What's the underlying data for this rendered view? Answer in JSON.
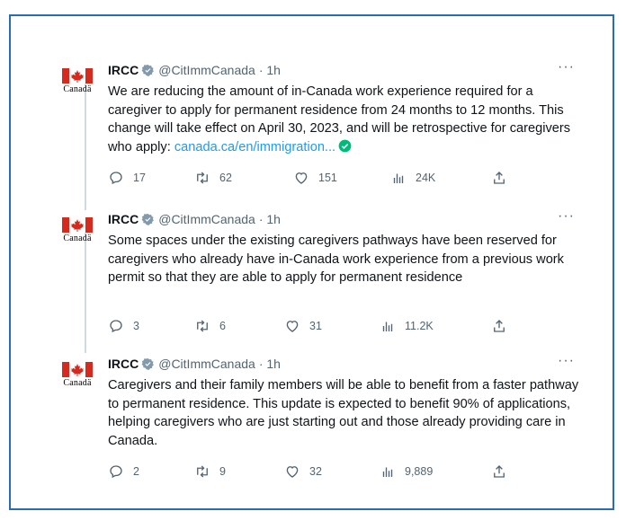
{
  "tweets": [
    {
      "name": "IRCC",
      "handle": "@CitImmCanada",
      "time": "· 1h",
      "avatar_wordmark": "Canadä",
      "more": "···",
      "text": "We are reducing the amount of in-Canada work experience required for a caregiver to apply for permanent residence from 24 months to 12 months. This change will take effect on April 30, 2023, and will be retrospective for caregivers who apply: ",
      "link": "canada.ca/en/immigration...",
      "stats": {
        "replies": "17",
        "retweets": "62",
        "likes": "151",
        "views": "24K"
      }
    },
    {
      "name": "IRCC",
      "handle": "@CitImmCanada",
      "time": "· 1h",
      "avatar_wordmark": "Canadä",
      "more": "···",
      "text": "Some spaces under the existing caregivers pathways have been reserved for caregivers who already have in-Canada work experience from a previous work permit so that they are able to apply for permanent residence",
      "stats": {
        "replies": "3",
        "retweets": "6",
        "likes": "31",
        "views": "11.2K"
      }
    },
    {
      "name": "IRCC",
      "handle": "@CitImmCanada",
      "time": "· 1h",
      "avatar_wordmark": "Canadä",
      "more": "···",
      "text": "Caregivers and their family members will be able to benefit from a faster pathway to permanent residence. This update is expected to benefit 90% of applications, helping caregivers who are just starting out and those already providing care in Canada.",
      "stats": {
        "replies": "2",
        "retweets": "9",
        "likes": "32",
        "views": "9,889"
      }
    }
  ],
  "colors": {
    "frame": "#2a6cb3",
    "link": "#1d9bf0",
    "flag_red": "#d52b1e",
    "muted": "#536471",
    "verified": "#829aab",
    "check": "#00ba7c"
  },
  "icons": [
    "verified-badge-icon",
    "more-icon",
    "reply-icon",
    "retweet-icon",
    "like-icon",
    "views-icon",
    "share-icon",
    "check-emoji-icon",
    "canada-flag-icon"
  ]
}
